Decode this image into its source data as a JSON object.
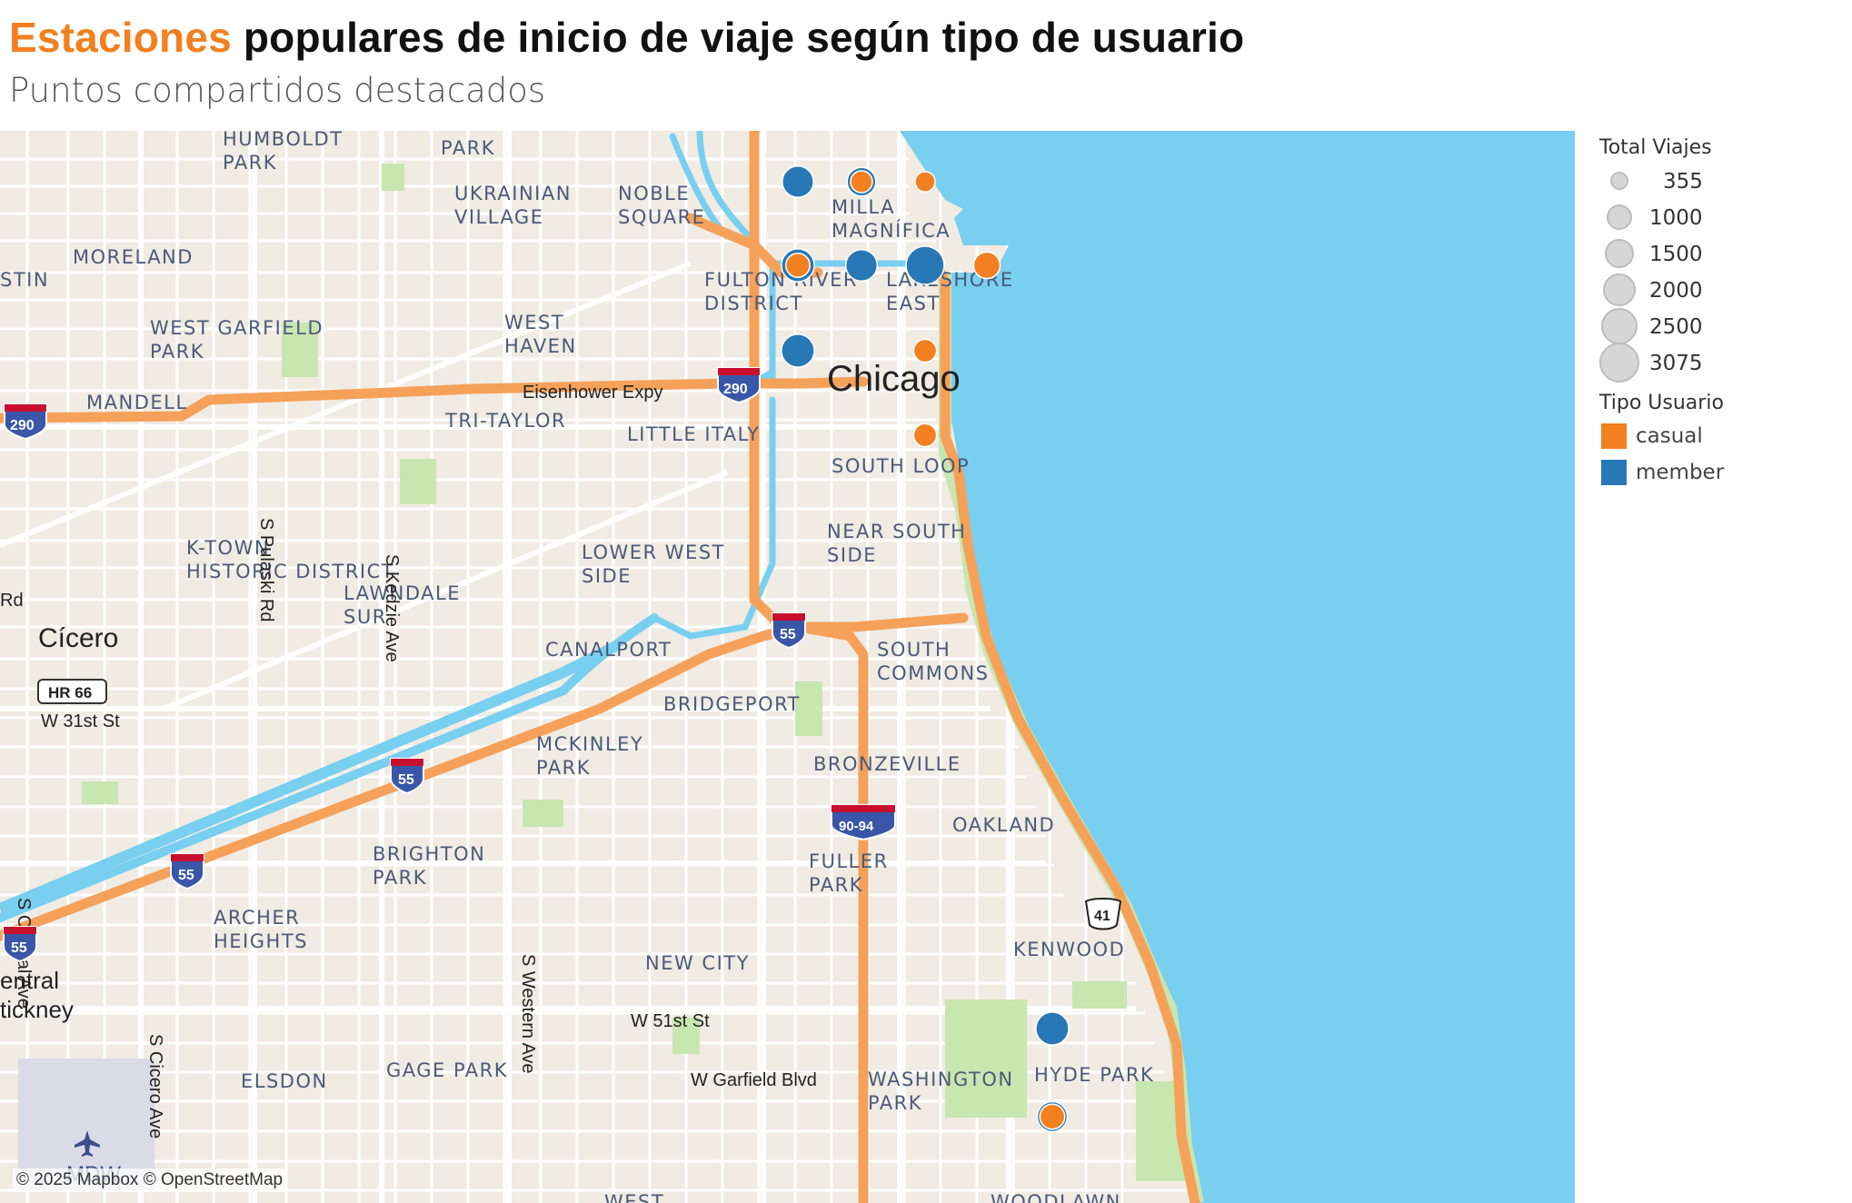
{
  "header": {
    "title_accent": "Estaciones",
    "title_rest": " populares de inicio de viaje según tipo de usuario",
    "subtitle": "Puntos compartidos destacados"
  },
  "legend": {
    "size_title": "Total Viajes",
    "size_items": [
      "355",
      "1000",
      "1500",
      "2000",
      "2500",
      "3075"
    ],
    "color_title": "Tipo Usuario",
    "color_items": [
      {
        "label": "casual",
        "color": "#f28020"
      },
      {
        "label": "member",
        "color": "#2878b5"
      }
    ]
  },
  "map": {
    "attribution": "© 2025 Mapbox © OpenStreetMap",
    "colors": {
      "land": "#f0ebe3",
      "water": "#78cff0",
      "park": "#c8e6b0",
      "highway": "#f5a15a",
      "road": "#ffffff"
    },
    "labels": {
      "humboldt": "HUMBOLDT PARK",
      "park": "PARK",
      "ukrainian": "UKRAINIAN VILLAGE",
      "noble": "NOBLE SQUARE",
      "milla": "MILLA MAGNÍFICA",
      "moreland": "MORELAND",
      "stin": "STIN",
      "fulton": "FULTON RIVER DISTRICT",
      "lakeshore": "LAKESHORE EAST",
      "wgarfield": "WEST GARFIELD PARK",
      "whaven": "WEST HAVEN",
      "chicago": "Chicago",
      "eisenhower": "Eisenhower Expy",
      "mandell": "MANDELL",
      "tritaylor": "TRI-TAYLOR",
      "littleitaly": "LITTLE ITALY",
      "southloop": "SOUTH LOOP",
      "pulaski": "S Pulaski Rd",
      "kedzie": "S Kedzie Ave",
      "nearsouth": "NEAR SOUTH SIDE",
      "ktown": "K-TOWN HISTORIC DISTRICT",
      "lowerwest": "LOWER WEST SIDE",
      "lawndale": "LAWNDALE SUR",
      "rd": "Rd",
      "cicero": "Cícero",
      "canalport": "CANALPORT",
      "southcommons": "SOUTH COMMONS",
      "hr66": "HR 66",
      "w31st": "W 31st St",
      "bridgeport": "BRIDGEPORT",
      "mckinley": "MCKINLEY PARK",
      "bronzeville": "BRONZEVILLE",
      "centralave": "S Central Ave",
      "westernave": "S Western Ave",
      "oakland": "OAKLAND",
      "brighton": "BRIGHTON PARK",
      "fuller": "FULLER PARK",
      "archer": "ARCHER HEIGHTS",
      "ciceroave": "S Cicero Ave",
      "kenwood": "KENWOOD",
      "newcity": "NEW CITY",
      "central": "entral",
      "stickney": "tickney",
      "w51st": "W 51st St",
      "hydepark": "HYDE PARK",
      "gagepark": "GAGE PARK",
      "elsdon": "ELSDON",
      "wgarfieldblvd": "W Garfield Blvd",
      "washington": "WASHINGTON PARK",
      "mdw": "MDW",
      "west": "WEST",
      "woodlawn": "WOODLAWN"
    },
    "shields": {
      "i290": "290",
      "i55": "55",
      "i9094": "90-94",
      "us41": "41"
    },
    "stations": [
      {
        "user": "member",
        "total_viajes": 1700
      },
      {
        "user": "member",
        "total_viajes": 1300
      },
      {
        "user": "casual",
        "total_viajes": 500
      },
      {
        "user": "casual",
        "total_viajes": 355
      },
      {
        "user": "member",
        "total_viajes": 2000
      },
      {
        "user": "casual",
        "total_viajes": 700
      },
      {
        "user": "member",
        "total_viajes": 1750
      },
      {
        "user": "member",
        "total_viajes": 3075
      },
      {
        "user": "casual",
        "total_viajes": 1000
      },
      {
        "user": "member",
        "total_viajes": 2000
      },
      {
        "user": "casual",
        "total_viajes": 600
      },
      {
        "user": "casual",
        "total_viajes": 600
      },
      {
        "user": "member",
        "total_viajes": 2000
      },
      {
        "user": "member",
        "total_viajes": 1500
      },
      {
        "user": "casual",
        "total_viajes": 800
      }
    ]
  }
}
